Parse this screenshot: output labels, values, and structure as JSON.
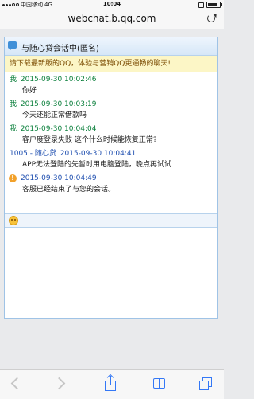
{
  "status_bar": {
    "carrier": "中国移动",
    "network": "4G",
    "time": "10:04"
  },
  "address_bar": {
    "url": "webchat.b.qq.com"
  },
  "chat": {
    "title": "与随心贷会话中(匿名)",
    "notice": "请下载最新版的QQ，体验与营销QQ更通畅的聊天!",
    "messages": [
      {
        "sender": "我",
        "timestamp": "2015-09-30 10:02:46",
        "text": "你好"
      },
      {
        "sender": "我",
        "timestamp": "2015-09-30 10:03:19",
        "text": "今天还能正常借款吗"
      },
      {
        "sender": "我",
        "timestamp": "2015-09-30 10:04:04",
        "text": "客户度登录失败 这个什么时候能恢复正常?"
      },
      {
        "sender": "1005 - 随心贷",
        "timestamp": "2015-09-30 10:04:41",
        "text": "APP无法登陆的先暂时用电脑登陆，晚点再试试"
      },
      {
        "sender": "",
        "timestamp": "2015-09-30 10:04:49",
        "text": "客服已经结束了与您的会话。"
      }
    ]
  },
  "icons": {
    "reload": "reload-icon",
    "chat": "chat-bubble-icon",
    "info": "info-icon",
    "emoji": "emoji-icon",
    "back": "back-arrow-icon",
    "forward": "forward-arrow-icon",
    "share": "share-icon",
    "bookmarks": "bookmarks-icon",
    "tabs": "tabs-icon"
  },
  "colors": {
    "customer_sender": "#0a7f3b",
    "agent_sender": "#1f4fb0",
    "notice_text": "#7a4a00",
    "notice_bg": "#fcf6c6",
    "safari_blue": "#3478f6"
  }
}
